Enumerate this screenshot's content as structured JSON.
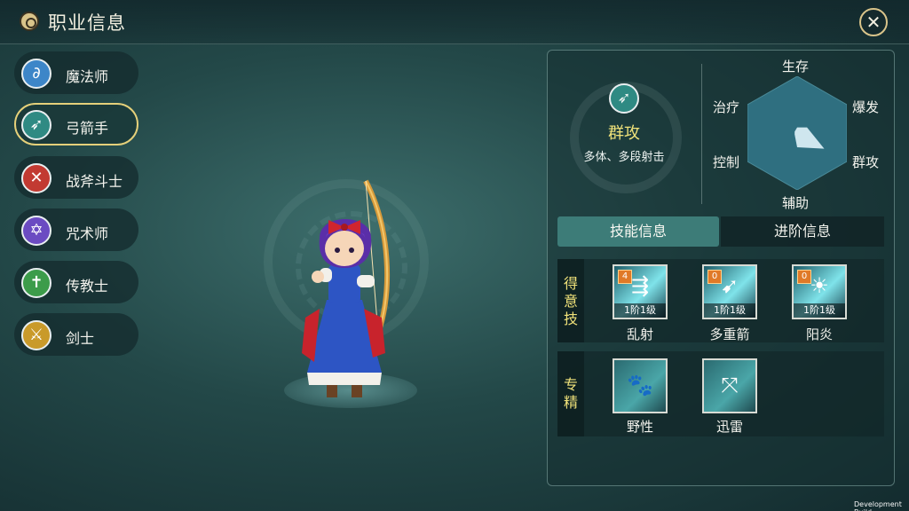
{
  "header": {
    "title": "职业信息",
    "close_label": "✕"
  },
  "classes": [
    {
      "label": "魔法师",
      "icon": "magic-staff-icon",
      "glyph": "∂",
      "color": "#3d86c8",
      "selected": false
    },
    {
      "label": "弓箭手",
      "icon": "bow-icon",
      "glyph": "➶",
      "color": "#2f8a83",
      "selected": true
    },
    {
      "label": "战斧斗士",
      "icon": "axe-icon",
      "glyph": "✕",
      "color": "#c23a32",
      "selected": false
    },
    {
      "label": "咒术师",
      "icon": "hexagram-icon",
      "glyph": "✡",
      "color": "#6b4bc2",
      "selected": false
    },
    {
      "label": "传教士",
      "icon": "cross-icon",
      "glyph": "✝",
      "color": "#3c9c4a",
      "selected": false
    },
    {
      "label": "剑士",
      "icon": "sword-icon",
      "glyph": "⚔",
      "color": "#c99a2a",
      "selected": false
    }
  ],
  "specialty": {
    "name": "群攻",
    "description": "多体、多段射击",
    "icon": "bow-icon"
  },
  "radar": {
    "labels": {
      "top": "生存",
      "top_right": "爆发",
      "bottom_right": "群攻",
      "bottom": "辅助",
      "bottom_left": "控制",
      "top_left": "治疗"
    },
    "values": {
      "生存": 0.1,
      "爆发": 0.2,
      "群攻": 0.55,
      "辅助": 0.25,
      "控制": 0.05,
      "治疗": 0.05
    }
  },
  "tabs": [
    {
      "label": "技能信息",
      "active": true
    },
    {
      "label": "进阶信息",
      "active": false
    }
  ],
  "skills_section": {
    "tag": "得意技",
    "skills": [
      {
        "name": "乱射",
        "level_badge": "4",
        "grade": "1阶1级",
        "icon": "arrow-rain-icon"
      },
      {
        "name": "多重箭",
        "level_badge": "0",
        "grade": "1阶1级",
        "icon": "multi-arrow-icon"
      },
      {
        "name": "阳炎",
        "level_badge": "0",
        "grade": "1阶1级",
        "icon": "sun-flame-icon"
      }
    ]
  },
  "specialty_section": {
    "tag": "专精",
    "items": [
      {
        "name": "野性",
        "icon": "paw-icon"
      },
      {
        "name": "迅雷",
        "icon": "crossed-arrows-icon"
      }
    ]
  },
  "footer": {
    "build_label": "Development Build"
  },
  "colors": {
    "accent_gold": "#e5d07a",
    "highlight_text": "#f0e27a",
    "tab_active": "#3d7c78"
  }
}
